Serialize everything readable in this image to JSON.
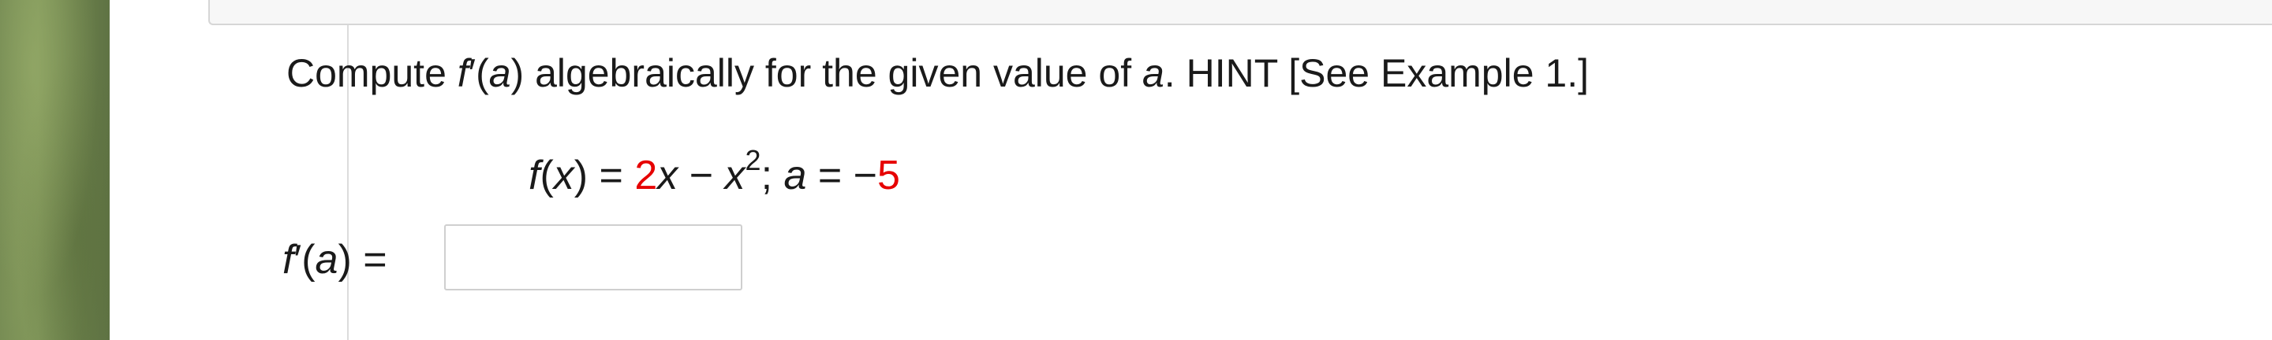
{
  "question": {
    "prompt_before_f": "Compute ",
    "f_symbol": "f",
    "prime_open": "′(",
    "prompt_var_a": "a",
    "prompt_middle": ") algebraically for the given value of ",
    "prompt_var_a2": "a",
    "prompt_end": ". HINT [See Example 1.]",
    "function": {
      "f_name": "f",
      "open_x": "(",
      "x_var": "x",
      "close_eq": ") = ",
      "coef": "2",
      "x_var2": "x",
      "minus": " − ",
      "x_var3": "x",
      "power": "2",
      "sep": "; ",
      "a_var": "a",
      "eq_neg": " = −",
      "a_value": "5"
    }
  },
  "answer": {
    "label_f": "f",
    "label_prime": "′(",
    "label_a": "a",
    "label_end": ") =",
    "value": "",
    "placeholder": ""
  }
}
